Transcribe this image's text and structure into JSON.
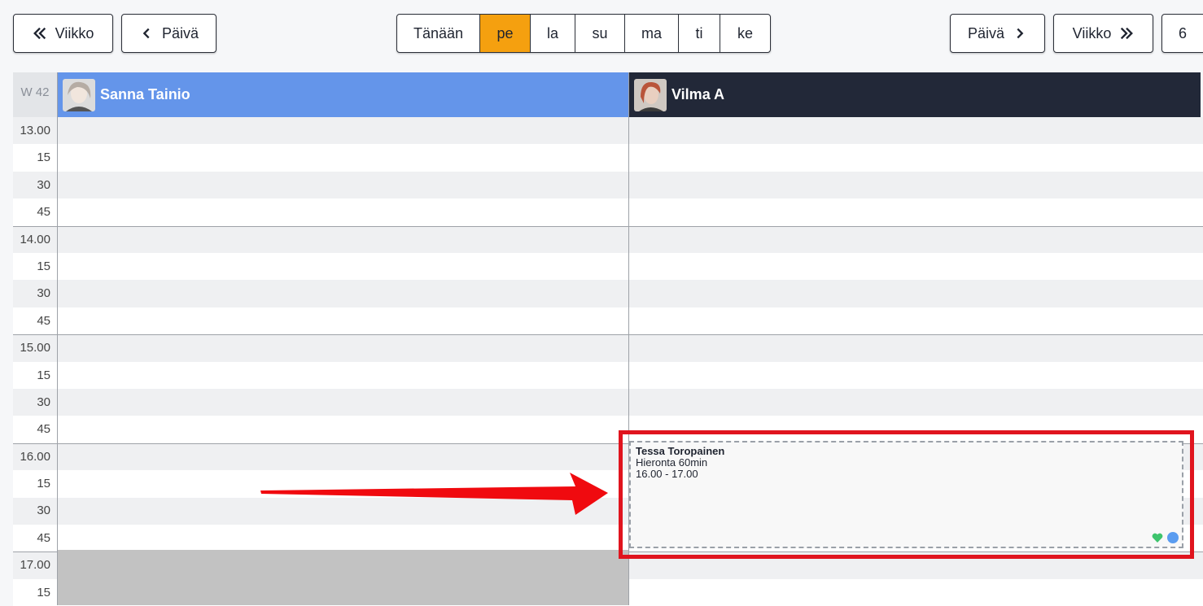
{
  "nav": {
    "prev_week": "Viikko",
    "prev_day": "Päivä",
    "next_day": "Päivä",
    "next_week": "Viikko",
    "days_shown": "6",
    "today": "Tänään",
    "days": [
      "pe",
      "la",
      "su",
      "ma",
      "ti",
      "ke"
    ],
    "active_day": "pe"
  },
  "calendar": {
    "week_label": "W 42",
    "staff": [
      {
        "name": "Sanna Tainio",
        "header_color": "#6495ea"
      },
      {
        "name": "Vilma A",
        "header_color": "#222838"
      }
    ],
    "time_rows": [
      "13.00",
      "15",
      "30",
      "45",
      "14.00",
      "15",
      "30",
      "45",
      "15.00",
      "15",
      "30",
      "45",
      "16.00",
      "15",
      "30",
      "45",
      "17.00",
      "15"
    ]
  },
  "booking": {
    "client": "Tessa Toropainen",
    "service": "Hieronta 60min",
    "time": "16.00 - 17.00",
    "status_colors": [
      "#3ec46d",
      "#5a9cf0"
    ]
  },
  "colors": {
    "accent": "#f5a00f",
    "annotation": "#e0141e"
  }
}
